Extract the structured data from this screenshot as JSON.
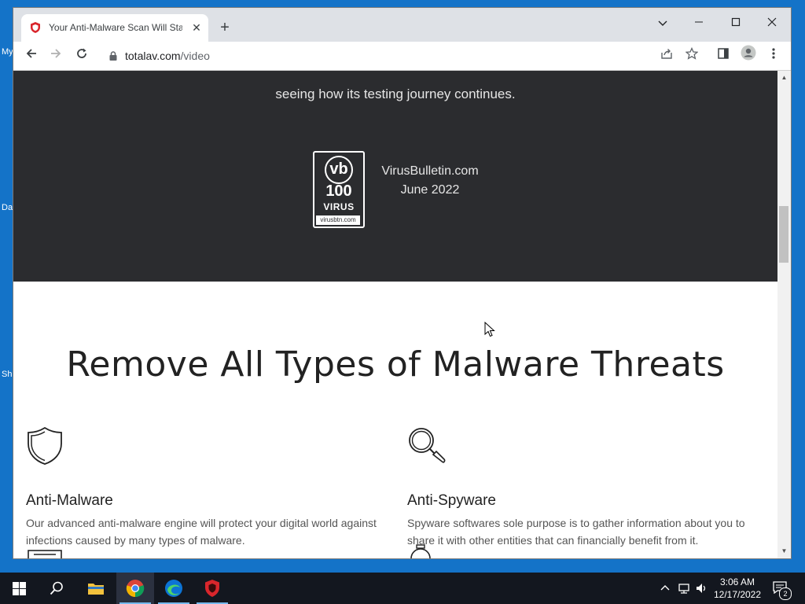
{
  "desktop": {
    "labels": [
      "My",
      "Da",
      "Sh"
    ]
  },
  "browser": {
    "tab": {
      "title": "Your Anti-Malware Scan Will Start",
      "close_icon": "close-icon"
    },
    "new_tab_icon": "plus-icon",
    "window_controls": [
      "chevron-down-icon",
      "minimize-icon",
      "maximize-icon",
      "close-icon"
    ],
    "url": {
      "host": "totalav.com",
      "path": "/video"
    }
  },
  "page": {
    "journey_text": "seeing how its testing journey continues.",
    "badge": {
      "logo": "vb",
      "number": "100",
      "word": "VIRUS",
      "site": "virusbtn.com"
    },
    "badge_caption": {
      "line1": "VirusBulletin.com",
      "line2": "June 2022"
    },
    "heading": "Remove All Types of Malware Threats",
    "features": [
      {
        "icon": "shield-icon",
        "title": "Anti-Malware",
        "desc": "Our advanced anti-malware engine will protect your digital world against infections caused by many types of malware."
      },
      {
        "icon": "magnifier-icon",
        "title": "Anti-Spyware",
        "desc": "Spyware softwares sole purpose is to gather information about you to share it with other entities that can financially benefit from it."
      }
    ]
  },
  "taskbar": {
    "clock": {
      "time": "3:06 AM",
      "date": "12/17/2022"
    },
    "notifications": "2"
  },
  "colors": {
    "dark_section": "#2b2c2f",
    "desktop_bg": "#1473c8",
    "taskbar": "#13171f"
  }
}
